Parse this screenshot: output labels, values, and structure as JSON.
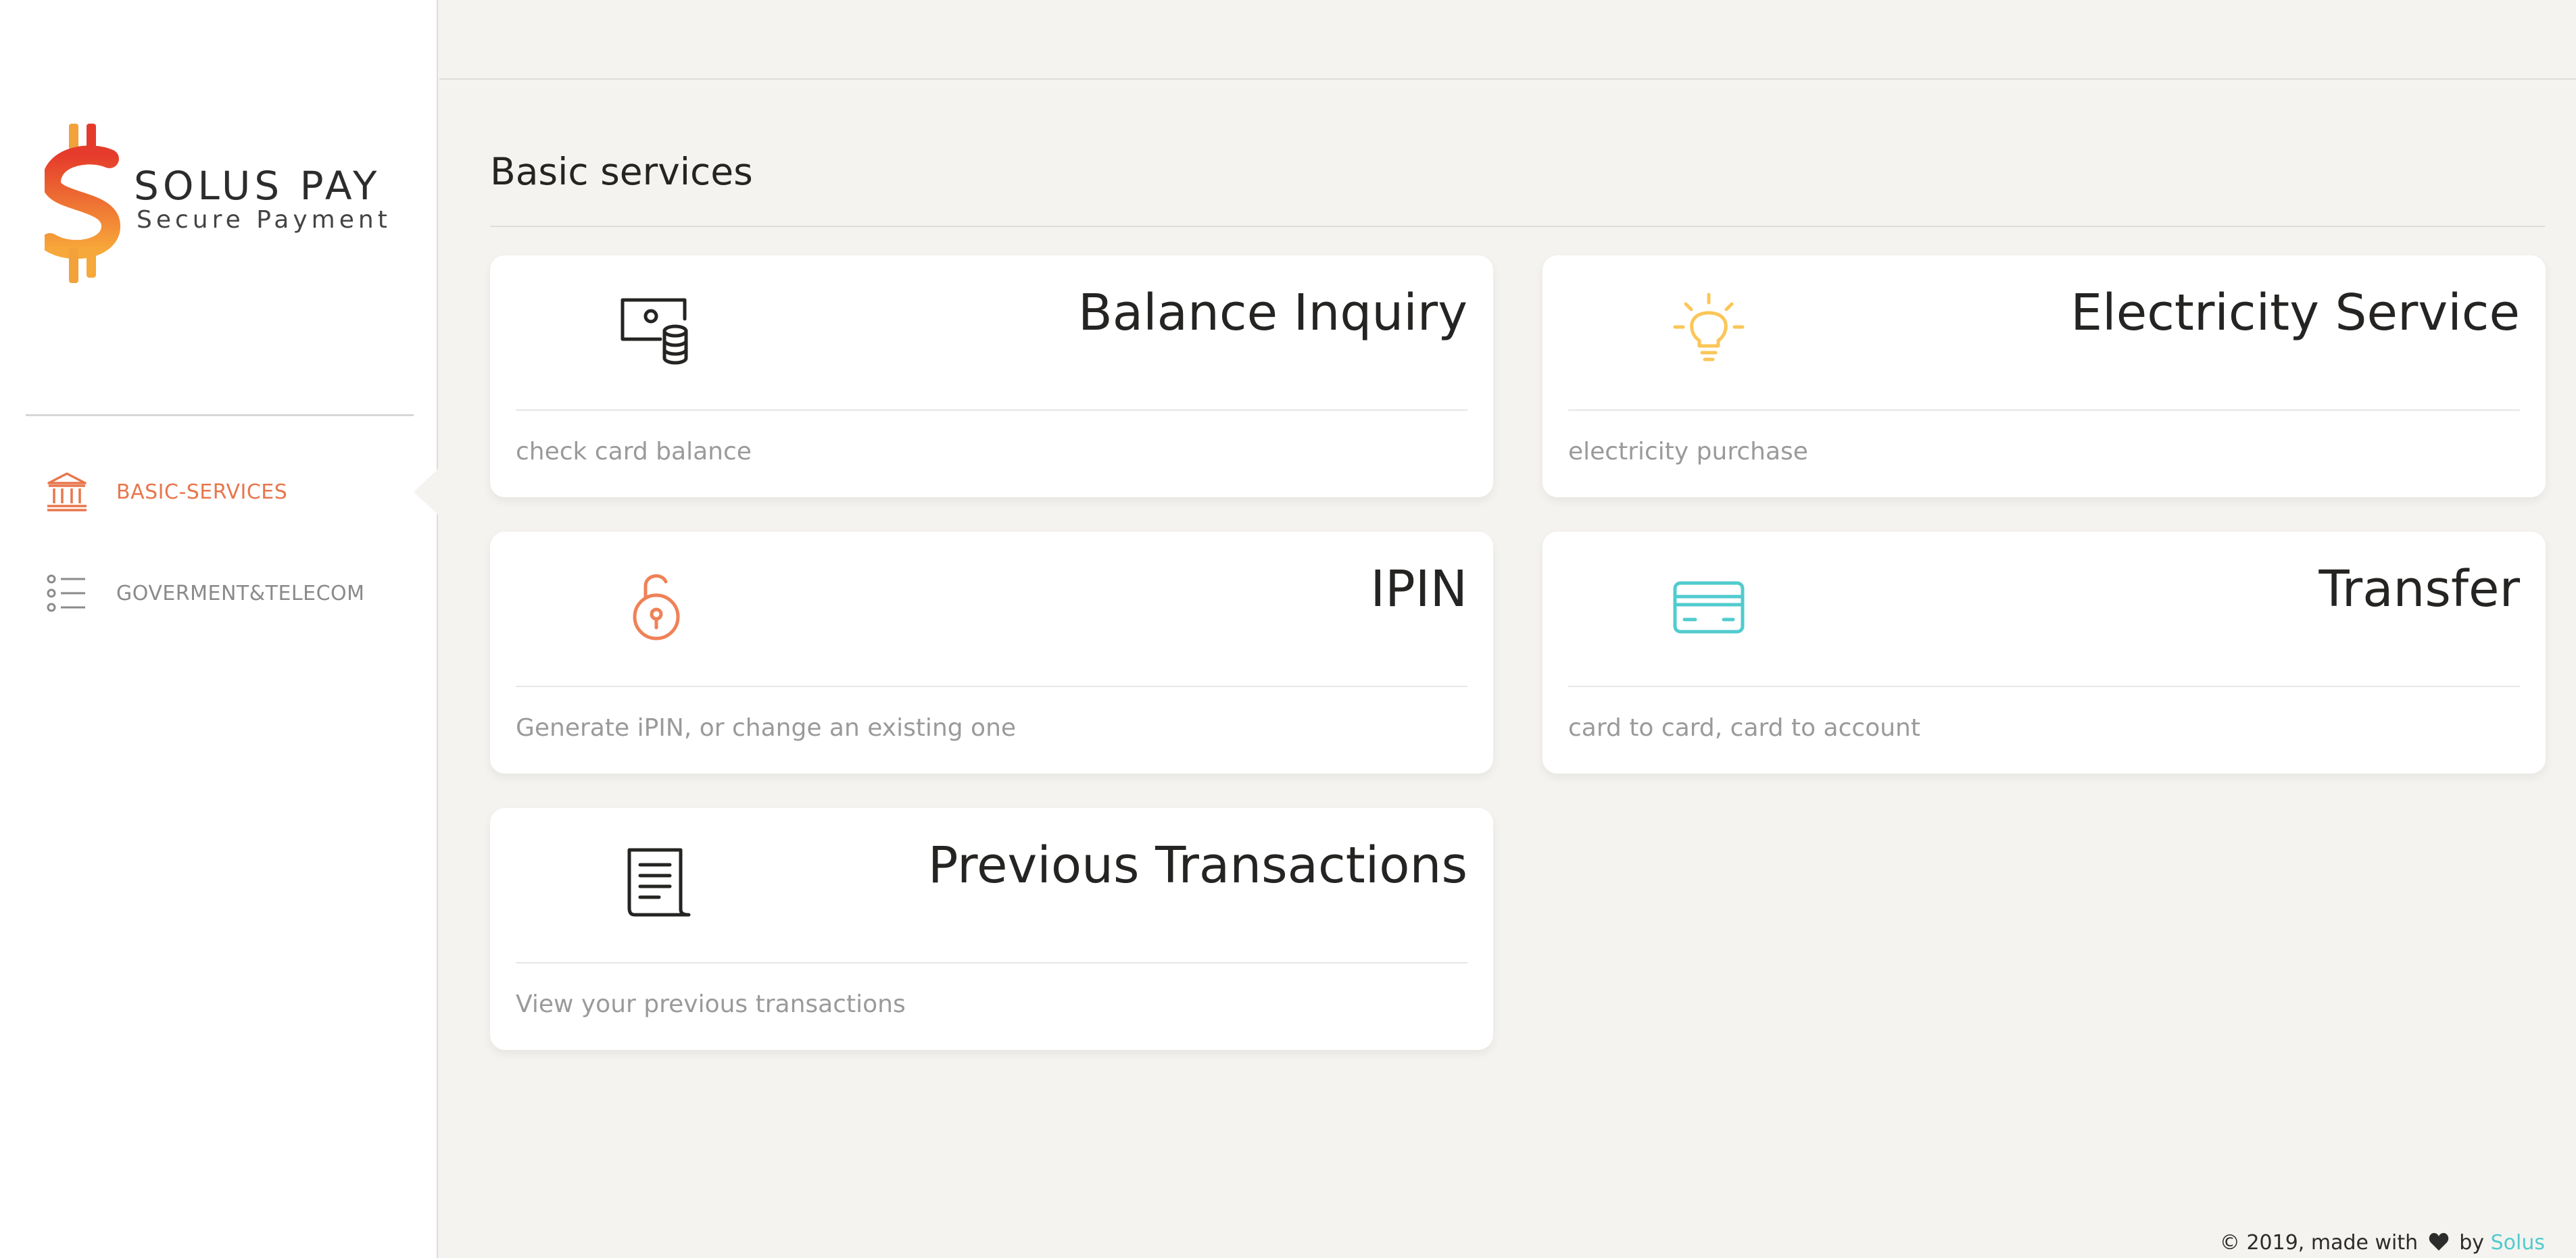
{
  "brand": {
    "name": "SOLUS PAY",
    "tagline": "Secure Payment"
  },
  "sidebar": {
    "items": [
      {
        "label": "BASIC-SERVICES",
        "icon": "bank-icon",
        "active": true
      },
      {
        "label": "GOVERMENT&TELECOM",
        "icon": "list-icon",
        "active": false
      }
    ]
  },
  "main": {
    "title": "Basic services",
    "cards": [
      {
        "title": "Balance Inquiry",
        "description": "check card balance",
        "icon": "money-coins-icon",
        "icon_color": "#252422"
      },
      {
        "title": "Electricity Service",
        "description": "electricity purchase",
        "icon": "bulb-icon",
        "icon_color": "#fbc658"
      },
      {
        "title": "IPIN",
        "description": "Generate iPIN, or change an existing one",
        "icon": "unlock-icon",
        "icon_color": "#ef8157"
      },
      {
        "title": "Transfer",
        "description": "card to card, card to account",
        "icon": "credit-card-icon",
        "icon_color": "#51cbce"
      },
      {
        "title": "Previous Transactions",
        "description": "View your previous transactions",
        "icon": "receipt-icon",
        "icon_color": "#252422"
      }
    ]
  },
  "footer": {
    "prefix": "© 2019, made with",
    "by": "by",
    "link": "Solus",
    "link_color": "#51cbce"
  },
  "colors": {
    "accent": "#e8764c",
    "background": "#f4f3ef",
    "sidebar": "#ffffff"
  }
}
